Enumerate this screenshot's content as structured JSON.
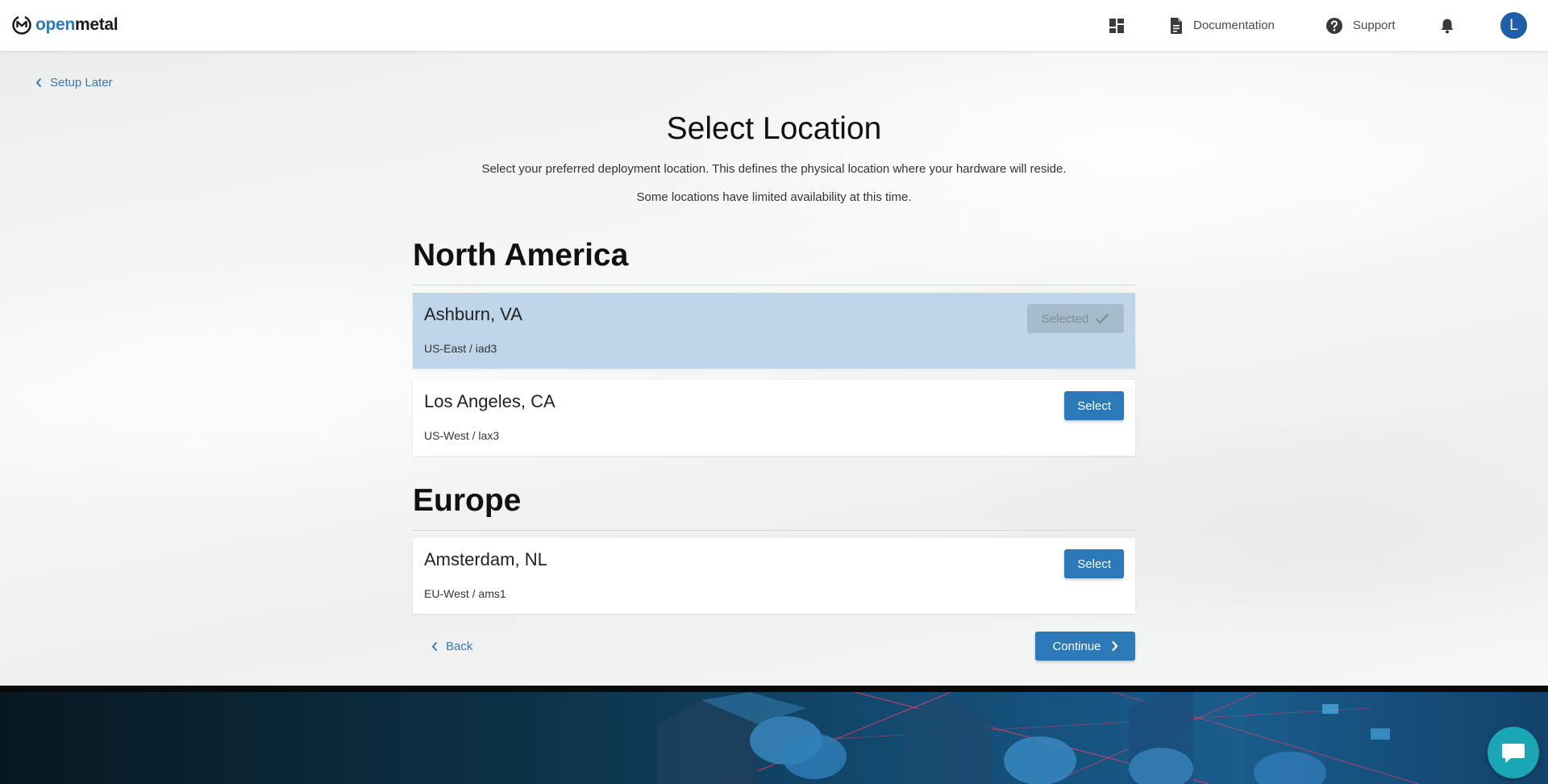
{
  "header": {
    "logo": {
      "part1": "open",
      "part2": "metal"
    },
    "nav": {
      "dashboard_icon": "dashboard-grid-icon",
      "documentation_label": "Documentation",
      "support_label": "Support",
      "notifications_icon": "bell-icon",
      "avatar_initial": "L"
    }
  },
  "setup_later_label": "Setup Later",
  "page": {
    "title": "Select Location",
    "subtitle_1": "Select your preferred deployment location. This defines the physical location where your hardware will reside.",
    "subtitle_2": "Some locations have limited availability at this time."
  },
  "regions": [
    {
      "name": "North America",
      "locations": [
        {
          "city": "Ashburn, VA",
          "code": "US-East / iad3",
          "state": "selected",
          "button_label": "Selected"
        },
        {
          "city": "Los Angeles, CA",
          "code": "US-West / lax3",
          "state": "available",
          "button_label": "Select"
        }
      ]
    },
    {
      "name": "Europe",
      "locations": [
        {
          "city": "Amsterdam, NL",
          "code": "EU-West / ams1",
          "state": "available",
          "button_label": "Select"
        }
      ]
    }
  ],
  "footer_nav": {
    "back_label": "Back",
    "continue_label": "Continue"
  },
  "colors": {
    "primary": "#2b79b8",
    "selected_card": "#bfd6ea",
    "selected_button": "#a6bccd",
    "avatar": "#1f5ea8",
    "chat": "#1aa6b5"
  }
}
